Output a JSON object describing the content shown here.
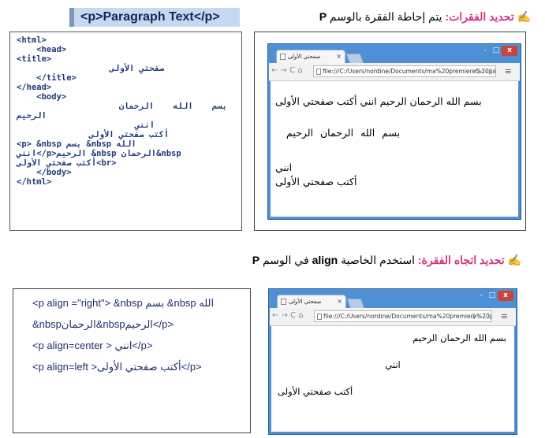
{
  "section1": {
    "heading_pink": "تحديد الفقرات:",
    "heading_text": "يتم إحاطة الفقرة بالوسم",
    "heading_tag": "P",
    "tag_box": "<p>Paragraph Text</p>",
    "pencil": "✍"
  },
  "code1": {
    "l1": "<html>",
    "l2": "    <head>",
    "l3": "<title>",
    "l4": "صفحتي الأولى",
    "l5": "    </title>",
    "l6": "</head>",
    "l7": "    <body>",
    "l8": "بسم الله الرحمان",
    "l9": "الرحيم",
    "l10": "انني",
    "l11": "أكتب صفحتي الأولى",
    "l12": "<p> &nbsp بسم &nbsp الله",
    "l13": "انني</p>الرحيم &nbsp الرحمان&nbsp",
    "l14": "أكتب صفحتي الأولى<br>",
    "l15": "    </body>",
    "l16": "</html>"
  },
  "browser": {
    "tab_title": "صفحتي الأولى",
    "tab_close": "×",
    "url": "file:///C:/Users/nordine/Documents/ma%20premiere%20page.htm",
    "url_tools": "Q☆ ⓘ",
    "menu": "≡",
    "nav": "← → C ⌂",
    "controls": [
      "-",
      "□",
      "x"
    ]
  },
  "browser1_content": {
    "line1": "بسم الله الرحمان الرحيم انني أكتب صفحتي الأولى",
    "line2": "بسم الله الرحمان الرحيم",
    "line3": "انني",
    "line4": "أكتب صفحتي الأولى"
  },
  "section2": {
    "heading_pink": "تحديد اتجاه الفقرة:",
    "heading_text": "استخدم الخاصية",
    "heading_attr": "align",
    "heading_text2": "في الوسم",
    "heading_tag": "P",
    "pencil": "✍"
  },
  "code2": {
    "l1": "<p align =\"right\"> &nbsp بسم &nbsp الله",
    "l2": "&nbspالرحمان&nbspالرحيم</p>",
    "l3": "<p align=center > انني</p>",
    "l4": "<p align=left >أكتب صفحتي الأولى</p>"
  },
  "browser2_content": {
    "line1": "بسم الله الرحمان الرحيم",
    "line2": "انني",
    "line3": "أكتب صفحتي الأولى"
  }
}
